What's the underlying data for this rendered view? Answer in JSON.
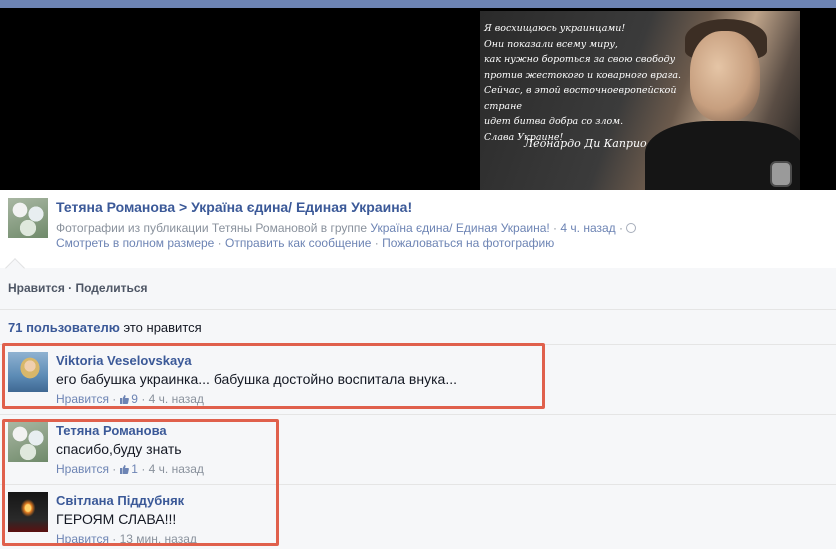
{
  "photo": {
    "quote_lines": [
      "Я восхищаюсь украинцами!",
      "Они показали всему миру,",
      "как нужно бороться за свою свободу",
      "против жестокого и коварного врага.",
      "Сейчас, в этой восточноевропейской стране",
      "идет битва добра со злом.",
      "Слава Украине!"
    ],
    "signature": "Леонардо Ди Каприо"
  },
  "post": {
    "author": "Тетяна Романова",
    "separator": " > ",
    "group": "Україна єдина/ Единая Украина!",
    "meta_prefix": "Фотографии из публикации Тетяны Романовой в группе",
    "meta_group_link": "Україна єдина/ Единая Украина!",
    "meta_time": "4 ч. назад",
    "actions": {
      "full_size": "Смотреть в полном размере",
      "send_message": "Отправить как сообщение",
      "report": "Пожаловаться на фотографию"
    }
  },
  "ufi": {
    "like": "Нравится",
    "share": "Поделиться",
    "like_count_link": "71 пользователю",
    "like_count_suffix": "это нравится"
  },
  "comments": [
    {
      "author": "Viktoria Veselovskaya",
      "text": "его бабушка украинка... бабушка достойно воспитала внука...",
      "like": "Нравится",
      "likes": "9",
      "time": "4 ч. назад"
    },
    {
      "author": "Тетяна Романова",
      "text": "спасибо,буду знать",
      "like": "Нравится",
      "likes": "1",
      "time": "4 ч. назад"
    },
    {
      "author": "Світлана Піддубняк",
      "text": "ГЕРОЯМ СЛАВА!!!",
      "like": "Нравится",
      "time": "13 мин. назад"
    }
  ],
  "colors": {
    "link": "#3b5998",
    "highlight": "#e0604c",
    "panel": "#f6f7f9"
  }
}
